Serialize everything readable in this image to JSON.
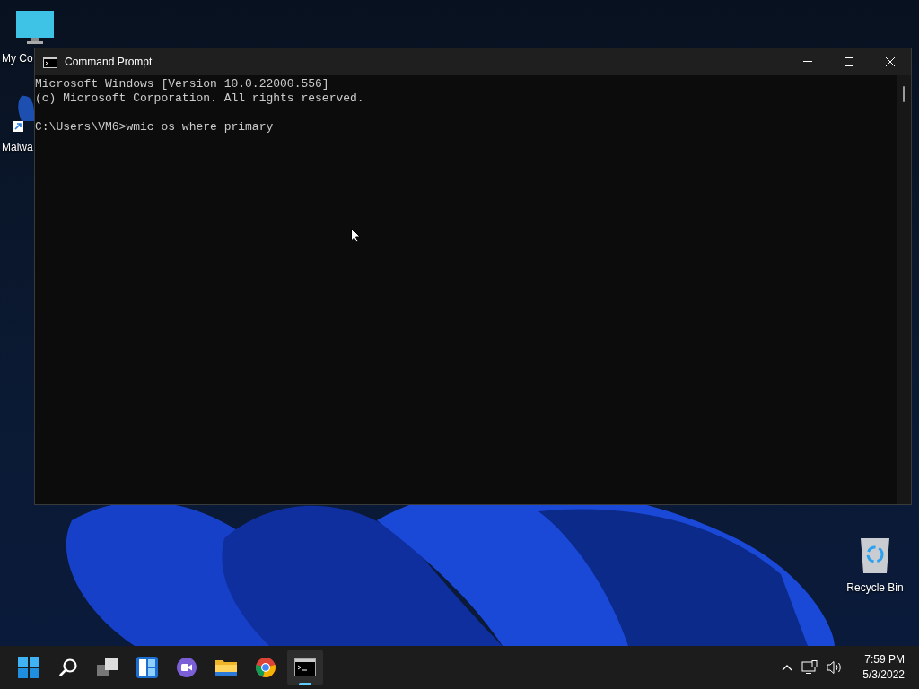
{
  "desktop_icons": [
    {
      "kind": "computer",
      "label": "My Co"
    },
    {
      "kind": "shortcut",
      "label": "Malwa"
    },
    {
      "kind": "recycle",
      "label": "Recycle Bin"
    }
  ],
  "window": {
    "title": "Command Prompt",
    "paragraphs": [
      [
        "Microsoft Windows [Version 10.0.22000.556]",
        "(c) Microsoft Corporation. All rights reserved."
      ],
      [
        "C:\\Users\\VM6>wmic os where primary"
      ]
    ]
  },
  "taskbar": {
    "apps": [
      {
        "kind": "start",
        "selected": false
      },
      {
        "kind": "search",
        "selected": false
      },
      {
        "kind": "taskview",
        "selected": false
      },
      {
        "kind": "widgets",
        "selected": false
      },
      {
        "kind": "chat",
        "selected": false
      },
      {
        "kind": "explorer",
        "selected": false
      },
      {
        "kind": "chrome",
        "selected": false
      },
      {
        "kind": "terminal",
        "selected": true
      }
    ],
    "time": "7:59 PM",
    "date": "5/3/2022"
  }
}
